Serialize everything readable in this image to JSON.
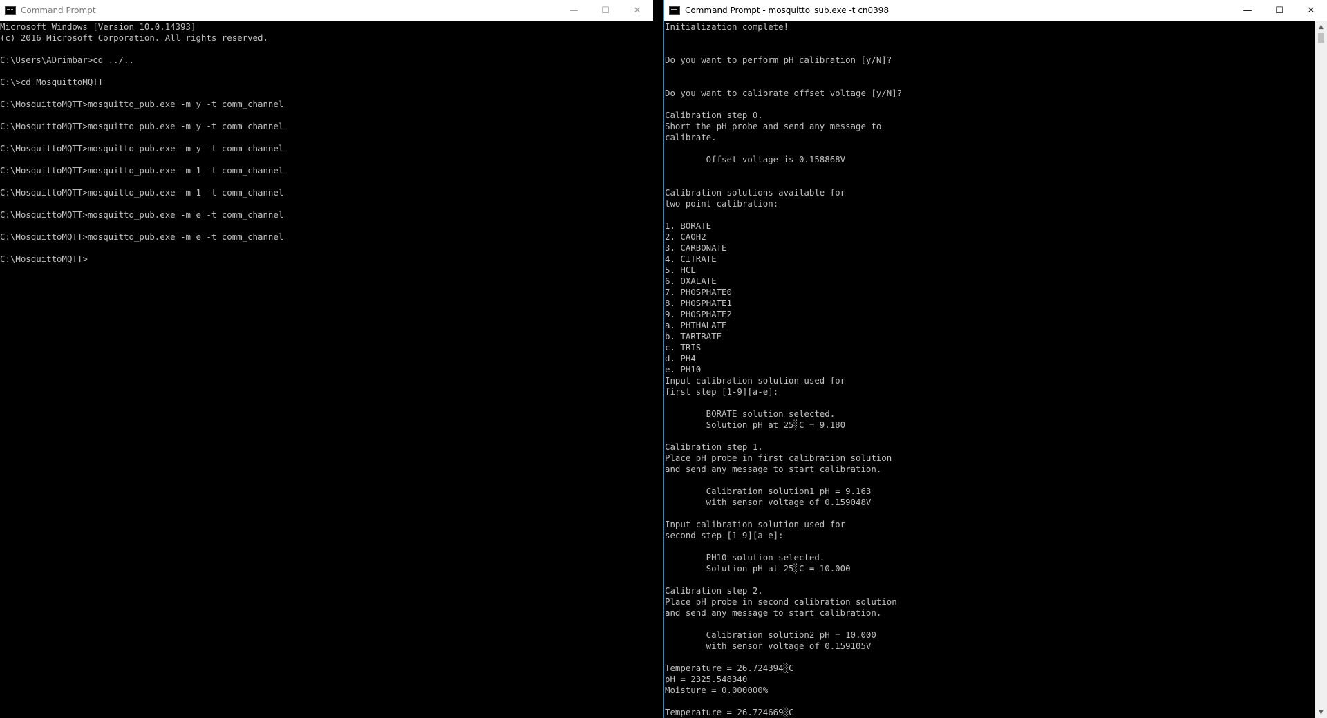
{
  "left_window": {
    "title": "Command Prompt",
    "controls": {
      "minimize": "—",
      "maximize": "☐",
      "close": "✕"
    },
    "lines": [
      "Microsoft Windows [Version 10.0.14393]",
      "(c) 2016 Microsoft Corporation. All rights reserved.",
      "",
      "C:\\Users\\ADrimbar>cd ../..",
      "",
      "C:\\>cd MosquittoMQTT",
      "",
      "C:\\MosquittoMQTT>mosquitto_pub.exe -m y -t comm_channel",
      "",
      "C:\\MosquittoMQTT>mosquitto_pub.exe -m y -t comm_channel",
      "",
      "C:\\MosquittoMQTT>mosquitto_pub.exe -m y -t comm_channel",
      "",
      "C:\\MosquittoMQTT>mosquitto_pub.exe -m 1 -t comm_channel",
      "",
      "C:\\MosquittoMQTT>mosquitto_pub.exe -m 1 -t comm_channel",
      "",
      "C:\\MosquittoMQTT>mosquitto_pub.exe -m e -t comm_channel",
      "",
      "C:\\MosquittoMQTT>mosquitto_pub.exe -m e -t comm_channel",
      "",
      "C:\\MosquittoMQTT>"
    ]
  },
  "right_window": {
    "title": "Command Prompt - mosquitto_sub.exe  -t cn0398",
    "controls": {
      "minimize": "—",
      "maximize": "☐",
      "close": "✕"
    },
    "scrollbar": {
      "up_arrow": "▲",
      "down_arrow": "▼"
    },
    "lines": [
      "Initialization complete!",
      "",
      "",
      "Do you want to perform pH calibration [y/N]?",
      "",
      "",
      "Do you want to calibrate offset voltage [y/N]?",
      "",
      "Calibration step 0.",
      "Short the pH probe and send any message to",
      "calibrate.",
      "",
      "        Offset voltage is 0.158868V",
      "",
      "",
      "Calibration solutions available for",
      "two point calibration:",
      "",
      "1. BORATE",
      "2. CAOH2",
      "3. CARBONATE",
      "4. CITRATE",
      "5. HCL",
      "6. OXALATE",
      "7. PHOSPHATE0",
      "8. PHOSPHATE1",
      "9. PHOSPHATE2",
      "a. PHTHALATE",
      "b. TARTRATE",
      "c. TRIS",
      "d. PH4",
      "e. PH10",
      "Input calibration solution used for",
      "first step [1-9][a-e]:",
      "",
      "        BORATE solution selected.",
      "        Solution pH at 25░C = 9.180",
      "",
      "Calibration step 1.",
      "Place pH probe in first calibration solution",
      "and send any message to start calibration.",
      "",
      "        Calibration solution1 pH = 9.163",
      "        with sensor voltage of 0.159048V",
      "",
      "Input calibration solution used for",
      "second step [1-9][a-e]:",
      "",
      "        PH10 solution selected.",
      "        Solution pH at 25░C = 10.000",
      "",
      "Calibration step 2.",
      "Place pH probe in second calibration solution",
      "and send any message to start calibration.",
      "",
      "        Calibration solution2 pH = 10.000",
      "        with sensor voltage of 0.159105V",
      "",
      "Temperature = 26.724394░C",
      "pH = 2325.548340",
      "Moisture = 0.000000%",
      "",
      "Temperature = 26.724669░C"
    ]
  }
}
